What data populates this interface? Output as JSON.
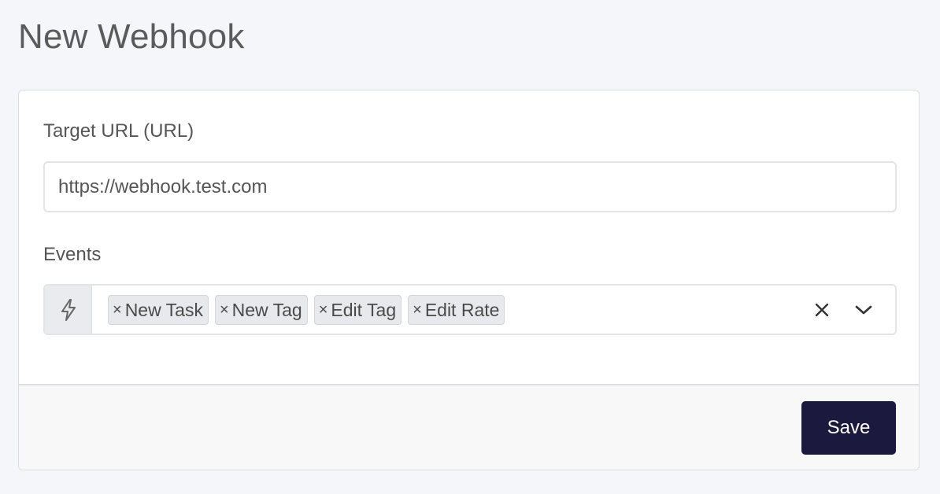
{
  "page": {
    "title": "New Webhook"
  },
  "form": {
    "target_url": {
      "label": "Target URL (URL)",
      "value": "https://webhook.test.com"
    },
    "events": {
      "label": "Events",
      "addon_icon": "lightning-bolt-icon",
      "selected": [
        {
          "remove_glyph": "×",
          "label": "New Task"
        },
        {
          "remove_glyph": "×",
          "label": "New Tag"
        },
        {
          "remove_glyph": "×",
          "label": "Edit Tag"
        },
        {
          "remove_glyph": "×",
          "label": "Edit Rate"
        }
      ],
      "clear_icon": "clear-x-icon",
      "dropdown_icon": "chevron-down-icon"
    }
  },
  "footer": {
    "save_label": "Save"
  },
  "colors": {
    "background": "#f5f6fa",
    "card": "#ffffff",
    "chip": "#e8e9ec",
    "save_button": "#1b1a3e"
  }
}
